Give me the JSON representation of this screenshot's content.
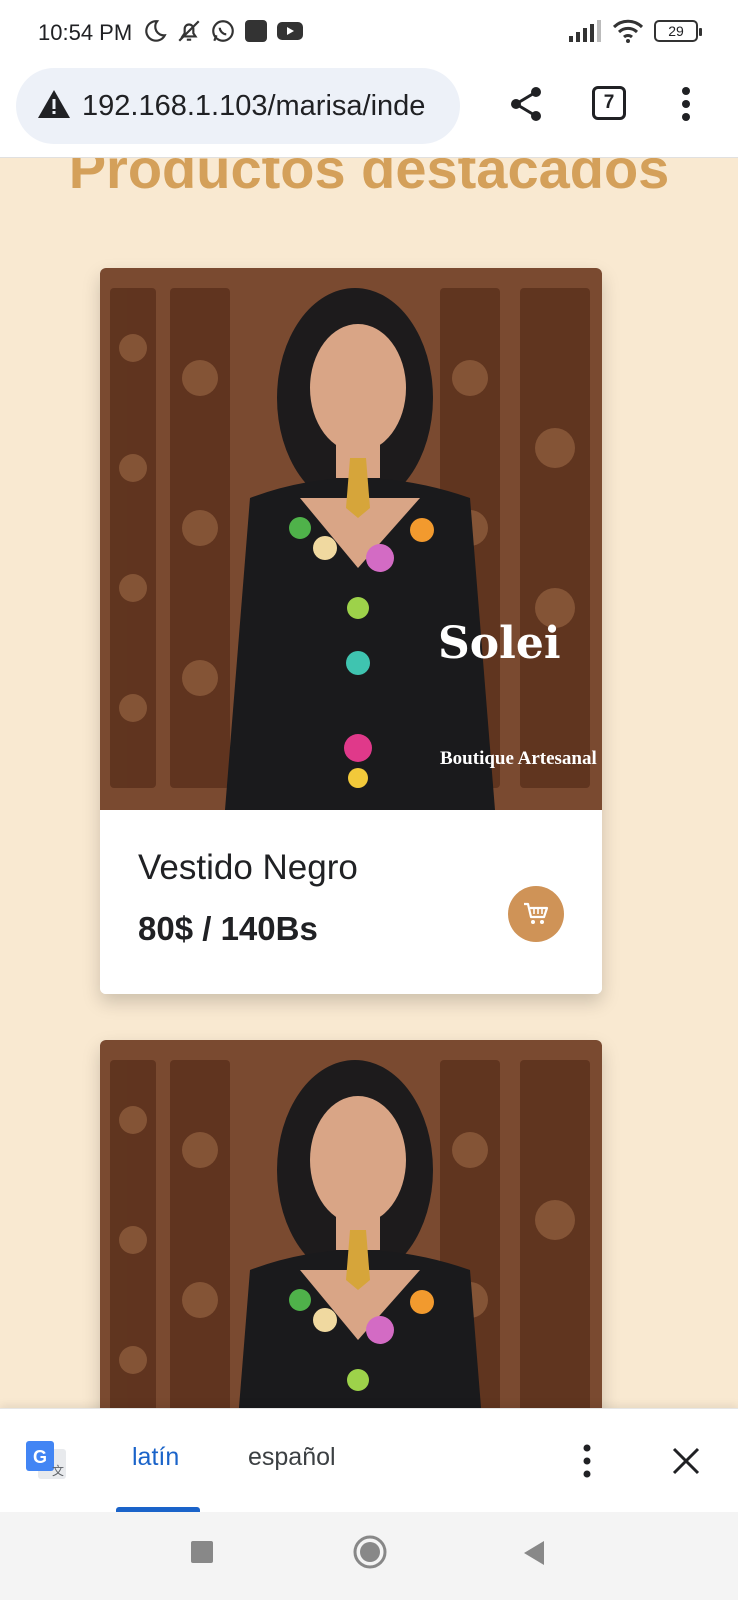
{
  "status_bar": {
    "time": "10:54 PM",
    "battery": "29",
    "icons_left": [
      "moon-icon",
      "bell-off-icon",
      "whatsapp-icon",
      "app-square-icon",
      "youtube-icon"
    ],
    "icons_right": [
      "signal-icon",
      "wifi-icon",
      "battery-icon"
    ]
  },
  "browser": {
    "url": "192.168.1.103/marisa/inde",
    "tab_count": "7",
    "icons": [
      "warning-icon",
      "share-icon",
      "tabs-icon",
      "more-vert-icon"
    ]
  },
  "page": {
    "section_title": "Productos destacados",
    "products": [
      {
        "name": "Vestido Negro",
        "price": "80$ / 140Bs",
        "image_watermark_brand": "Solei",
        "image_watermark_sub": "Boutique Artesanal"
      },
      {
        "image_watermark_brand": "",
        "image_watermark_sub": ""
      }
    ],
    "accent_color": "#cf9357",
    "background_color": "#f9e9d1"
  },
  "translate_bar": {
    "source_lang": "latín",
    "target_lang": "español",
    "active_color": "#1a63c9"
  },
  "nav_bar": {
    "buttons": [
      "recents-button",
      "home-button",
      "back-button"
    ]
  }
}
